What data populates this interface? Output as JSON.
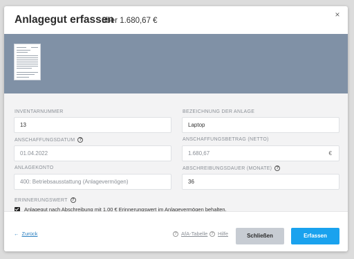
{
  "modal": {
    "title": "Anlagegut erfassen",
    "subtitle": "über 1.680,67 €",
    "close_icon": "×"
  },
  "preview": {
    "thumbnail_icon": "document-thumbnail-icon"
  },
  "form": {
    "inventory_number": {
      "label": "INVENTARNUMMER",
      "value": "13"
    },
    "asset_name": {
      "label": "BEZEICHNUNG DER ANLAGE",
      "value": "Laptop"
    },
    "acquisition_date": {
      "label": "ANSCHAFFUNGSDATUM",
      "value": "01.04.2022"
    },
    "acquisition_amount": {
      "label": "ANSCHAFFUNGSBETRAG (NETTO)",
      "value": "1.680,67",
      "suffix": "€"
    },
    "asset_account": {
      "label": "ANLAGEKONTO",
      "value": "400: Betriebsausstattung (Anlagevermögen)"
    },
    "depreciation_period": {
      "label": "ABSCHREIBUNGSDAUER (MONATE)",
      "value": "36"
    },
    "residual_value": {
      "label": "ERINNERUNGSWERT",
      "checkbox_label": "Anlagegut nach Abschreibung mit 1,00 € Erinnerungswert im Anlagevermögen behalten.",
      "checked": true
    },
    "help_glyph": "?"
  },
  "footer": {
    "back_arrow": "←",
    "back_label": "Zurück",
    "afa_label": "AfA-Tabelle",
    "help_label": "Hilfe",
    "close_label": "Schließen",
    "submit_label": "Erfassen"
  },
  "colors": {
    "preview_bg": "#8091a6",
    "primary": "#1aa2ee",
    "secondary": "#c7ccd3",
    "link": "#2a7fc0"
  }
}
